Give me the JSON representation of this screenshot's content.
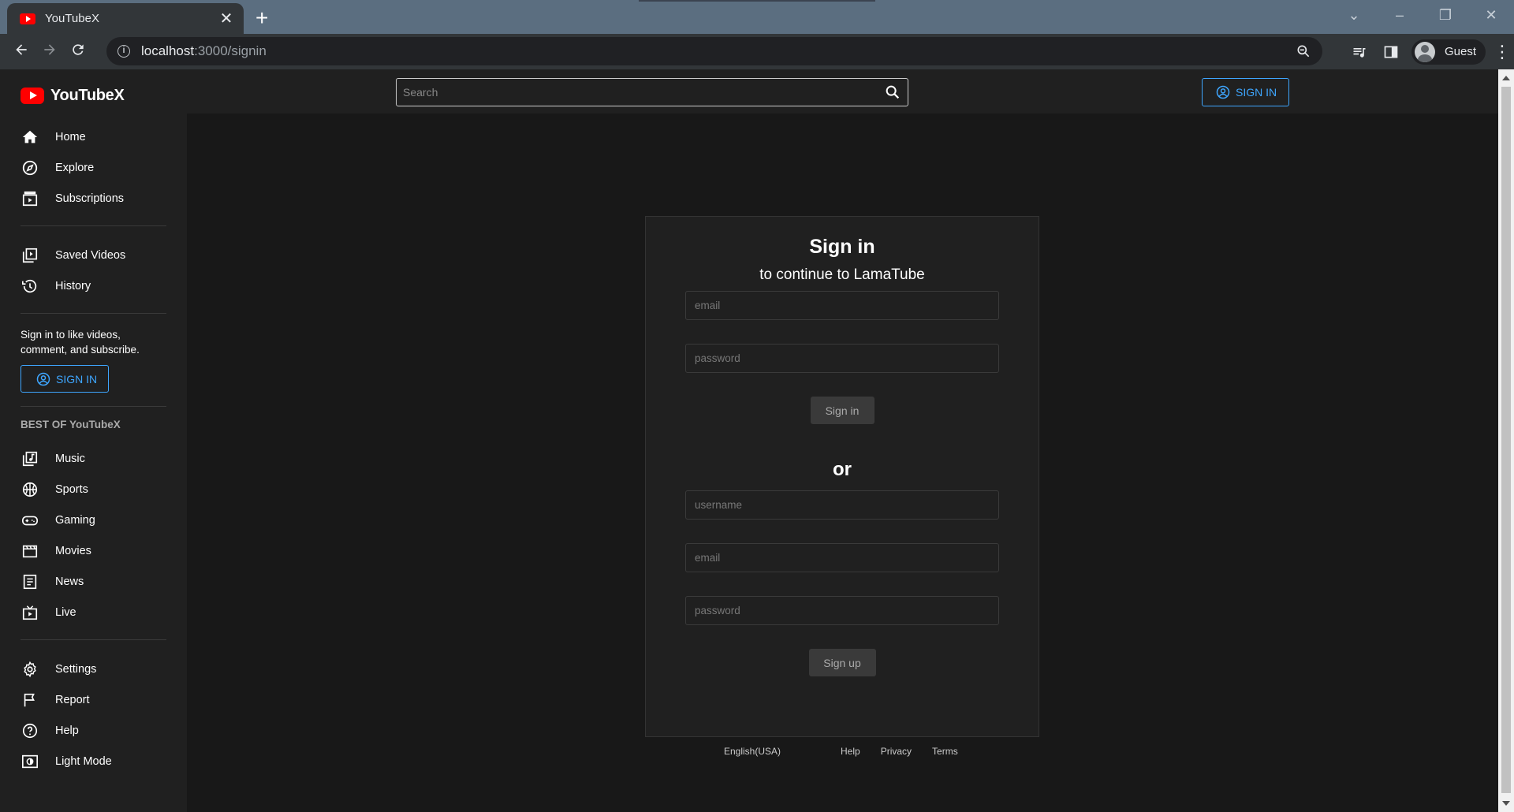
{
  "browser": {
    "tab_title": "YouTubeX",
    "tab_close": "✕",
    "new_tab": "+",
    "url_host": "localhost",
    "url_path": ":3000/signin",
    "profile_name": "Guest"
  },
  "app": {
    "logo_text": "YouTubeX",
    "search_placeholder": "Search",
    "top_signin_label": "SIGN IN",
    "sidebar": {
      "group1": [
        {
          "label": "Home",
          "icon": "home-icon"
        },
        {
          "label": "Explore",
          "icon": "compass-icon"
        },
        {
          "label": "Subscriptions",
          "icon": "subscriptions-icon"
        }
      ],
      "group2": [
        {
          "label": "Saved Videos",
          "icon": "video-library-icon"
        },
        {
          "label": "History",
          "icon": "history-icon"
        }
      ],
      "signin_note": "Sign in to like videos, comment, and subscribe.",
      "signin_label": "SIGN IN",
      "section_title": "BEST OF YouTubeX",
      "group3": [
        {
          "label": "Music",
          "icon": "music-library-icon"
        },
        {
          "label": "Sports",
          "icon": "sports-icon"
        },
        {
          "label": "Gaming",
          "icon": "gamepad-icon"
        },
        {
          "label": "Movies",
          "icon": "movie-icon"
        },
        {
          "label": "News",
          "icon": "article-icon"
        },
        {
          "label": "Live",
          "icon": "live-tv-icon"
        }
      ],
      "group4": [
        {
          "label": "Settings",
          "icon": "gear-icon"
        },
        {
          "label": "Report",
          "icon": "flag-icon"
        },
        {
          "label": "Help",
          "icon": "help-icon"
        },
        {
          "label": "Light Mode",
          "icon": "light-mode-icon"
        }
      ]
    },
    "signin_card": {
      "title": "Sign in",
      "subtitle": "to continue to LamaTube",
      "signin_email_placeholder": "email",
      "signin_password_placeholder": "password",
      "signin_button": "Sign in",
      "or_text": "or",
      "signup_username_placeholder": "username",
      "signup_email_placeholder": "email",
      "signup_password_placeholder": "password",
      "signup_button": "Sign up"
    },
    "footer": {
      "language": "English(USA)",
      "links": [
        "Help",
        "Privacy",
        "Terms"
      ]
    }
  }
}
